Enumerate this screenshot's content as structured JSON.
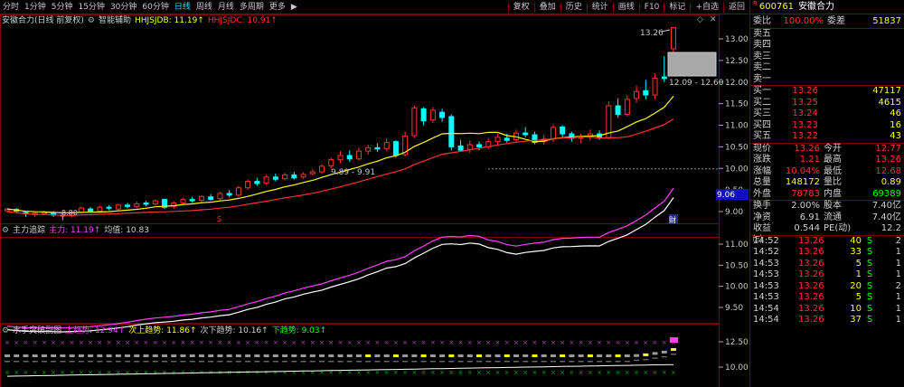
{
  "toolbar": {
    "periods": [
      "分时",
      "1分钟",
      "5分钟",
      "15分钟",
      "30分钟",
      "60分钟",
      "日线",
      "周线",
      "月线",
      "多周期",
      "更多"
    ],
    "active_period": "日线",
    "more_arrow": "▶",
    "buttons": [
      "复权",
      "叠加",
      "历史",
      "统计",
      "画线",
      "F10",
      "标记",
      "+自选",
      "返回"
    ]
  },
  "main_info": {
    "title": "安徽合力(日线 前复权)",
    "indicator": "智能辅助",
    "hhjsjdb": "HHJSJDB: 11.19↑",
    "hhjsjdc": "HHJSJDC: 10.91↑"
  },
  "main_axis": [
    "13.00",
    "12.50",
    "12.00",
    "11.50",
    "11.00",
    "10.50",
    "10.00",
    "9.50",
    "9.00"
  ],
  "main_annotations": {
    "high": "13.26",
    "range_label": "12.09 - 12.60",
    "low_label": "9.89 - 9.91",
    "min_label": "8.80",
    "current_tag": "9.06",
    "s_marker": "S",
    "cai_marker": "财"
  },
  "panel2_info": {
    "title": "主力追踪",
    "main_force": "主力: 11.19↑",
    "avg": "均值: 10.83"
  },
  "panel2_axis": [
    "11.00",
    "10.50",
    "10.00",
    "9.50"
  ],
  "panel3_info": {
    "title": "水手突破副图",
    "up": "上趋势: 12.94↑",
    "next_up": "次上趋势: 11.86↑",
    "next_down": "次下趋势: 10.16↑",
    "down": "下趋势: 9.03↑"
  },
  "panel3_axis": [
    "12.50",
    "10.00"
  ],
  "quote": {
    "code": "600761",
    "name": "安徽合力",
    "mark": "R",
    "wb_label": "委比",
    "wb_value": "100.00%",
    "wc_label": "委差",
    "wc_value": "51837",
    "asks": [
      {
        "label": "卖五",
        "price": "",
        "vol": ""
      },
      {
        "label": "卖四",
        "price": "",
        "vol": ""
      },
      {
        "label": "卖三",
        "price": "",
        "vol": ""
      },
      {
        "label": "卖二",
        "price": "",
        "vol": ""
      },
      {
        "label": "卖一",
        "price": "",
        "vol": ""
      }
    ],
    "bids": [
      {
        "label": "买一",
        "price": "13.26",
        "vol": "47117"
      },
      {
        "label": "买二",
        "price": "13.25",
        "vol": "4615"
      },
      {
        "label": "买三",
        "price": "13.24",
        "vol": "46"
      },
      {
        "label": "买四",
        "price": "13.23",
        "vol": "16"
      },
      {
        "label": "买五",
        "price": "13.22",
        "vol": "43"
      }
    ],
    "stats1": [
      {
        "l1": "现价",
        "v1": "13.26",
        "c1": "#ff3030",
        "l2": "今开",
        "v2": "12.77",
        "c2": "#ff3030"
      },
      {
        "l1": "涨跌",
        "v1": "1.21",
        "c1": "#ff3030",
        "l2": "最高",
        "v2": "13.26",
        "c2": "#ff3030"
      },
      {
        "l1": "涨幅",
        "v1": "10.04%",
        "c1": "#ff3030",
        "l2": "最低",
        "v2": "12.68",
        "c2": "#ff3030"
      },
      {
        "l1": "总量",
        "v1": "148172",
        "c1": "#ffff00",
        "l2": "量比",
        "v2": "0.89",
        "c2": "#ffff00"
      },
      {
        "l1": "外盘",
        "v1": "78783",
        "c1": "#ff3030",
        "l2": "内盘",
        "v2": "69389",
        "c2": "#00ff00"
      }
    ],
    "stats2": [
      {
        "l1": "换手",
        "v1": "2.00%",
        "c1": "#d0d0d0",
        "l2": "股本",
        "v2": "7.40亿",
        "c2": "#d0d0d0"
      },
      {
        "l1": "净资",
        "v1": "6.91",
        "c1": "#d0d0d0",
        "l2": "流通",
        "v2": "7.40亿",
        "c2": "#d0d0d0"
      },
      {
        "l1": "收益㈢",
        "v1": "0.544",
        "c1": "#d0d0d0",
        "l2": "PE(动)",
        "v2": "12.2",
        "c2": "#d0d0d0"
      }
    ],
    "ticks": [
      {
        "t": "14:52",
        "p": "13.26",
        "v": "40",
        "s": "S",
        "n": "2"
      },
      {
        "t": "14:52",
        "p": "13.26",
        "v": "33",
        "s": "S",
        "n": "1"
      },
      {
        "t": "14:53",
        "p": "13.26",
        "v": "5",
        "s": "S",
        "n": "1"
      },
      {
        "t": "14:53",
        "p": "13.26",
        "v": "1",
        "s": "S",
        "n": "1"
      },
      {
        "t": "14:53",
        "p": "13.26",
        "v": "20",
        "s": "S",
        "n": "2"
      },
      {
        "t": "14:53",
        "p": "13.26",
        "v": "5",
        "s": "S",
        "n": "1"
      },
      {
        "t": "14:54",
        "p": "13.26",
        "v": "10",
        "s": "S",
        "n": "1"
      },
      {
        "t": "14:54",
        "p": "13.26",
        "v": "37",
        "s": "S",
        "n": "1"
      }
    ]
  },
  "colors": {
    "up": "#ff3030",
    "down": "#00ffff",
    "border": "#7a0000",
    "ma1": "#ffff00",
    "ma2": "#ff3030",
    "line1": "#ff40ff",
    "line2": "#ffffff"
  }
}
